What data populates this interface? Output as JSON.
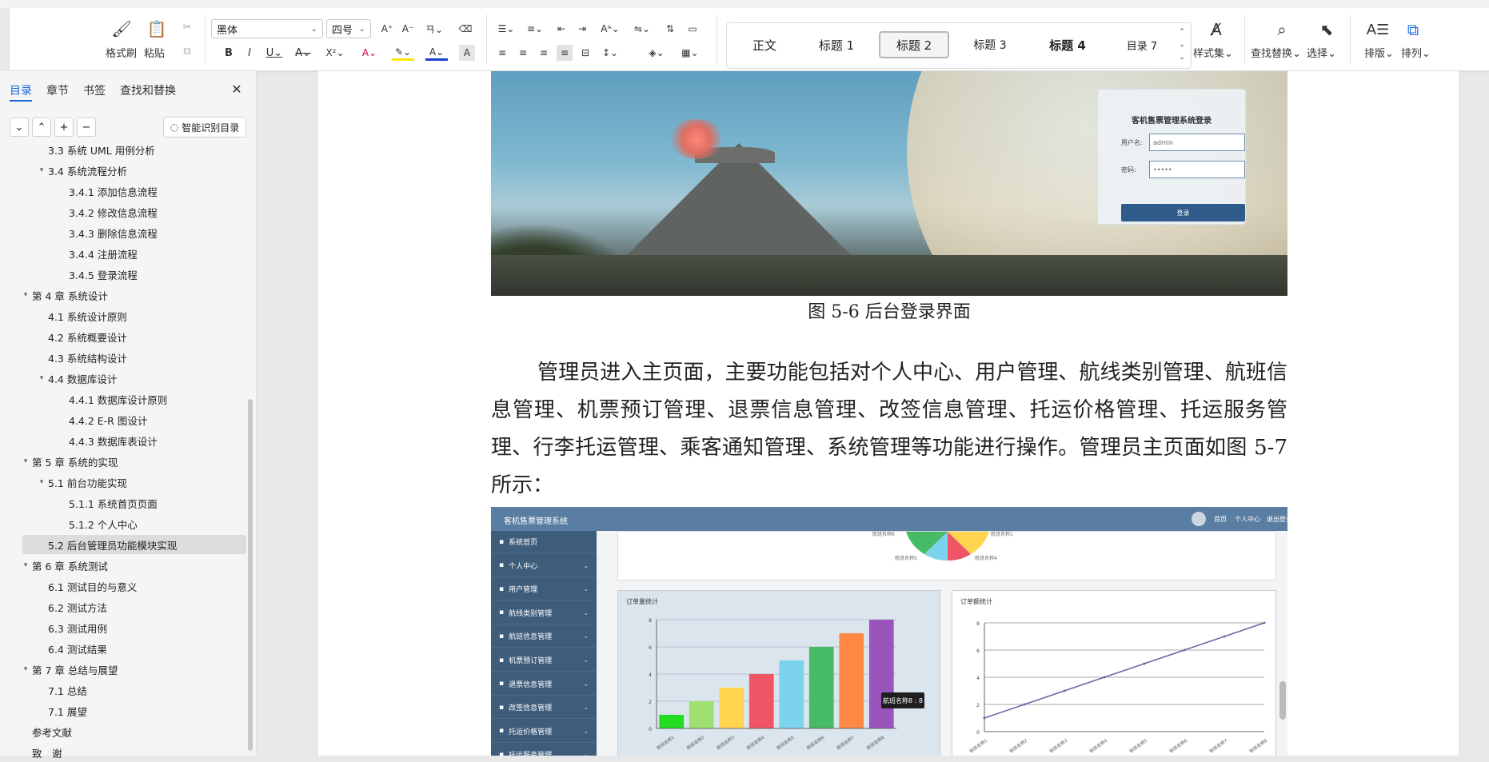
{
  "ribbon": {
    "clipboard": {
      "format_painter": "格式刷",
      "paste": "粘贴"
    },
    "font_name": "黑体",
    "font_size": "四号",
    "styles": [
      {
        "label": "正文"
      },
      {
        "label": "标题 1"
      },
      {
        "label": "标题 2",
        "selected": true
      },
      {
        "label": "标题 3"
      },
      {
        "label": "标题 4"
      },
      {
        "label": "目录 7"
      }
    ],
    "style_set": "样式集",
    "find_replace": "查找替换",
    "select": "选择",
    "layout": "排版",
    "arrange": "排列",
    "accent_color": "#1a66d9"
  },
  "nav": {
    "tabs": [
      "目录",
      "章节",
      "书签",
      "查找和替换"
    ],
    "smart_toc": "智能识别目录",
    "toc": [
      {
        "label": "3.3 系统 UML 用例分析",
        "level": 2,
        "expand": ""
      },
      {
        "label": "3.4 系统流程分析",
        "level": 2,
        "expand": "▾"
      },
      {
        "label": "3.4.1 添加信息流程",
        "level": 3,
        "expand": ""
      },
      {
        "label": "3.4.2 修改信息流程",
        "level": 3,
        "expand": ""
      },
      {
        "label": "3.4.3 删除信息流程",
        "level": 3,
        "expand": ""
      },
      {
        "label": "3.4.4 注册流程",
        "level": 3,
        "expand": ""
      },
      {
        "label": "3.4.5 登录流程",
        "level": 3,
        "expand": ""
      },
      {
        "label": "第 4 章 系统设计",
        "level": 1,
        "expand": "▾"
      },
      {
        "label": "4.1 系统设计原则",
        "level": 2,
        "expand": ""
      },
      {
        "label": "4.2 系统概要设计",
        "level": 2,
        "expand": ""
      },
      {
        "label": "4.3 系统结构设计",
        "level": 2,
        "expand": ""
      },
      {
        "label": "4.4 数据库设计",
        "level": 2,
        "expand": "▾"
      },
      {
        "label": "4.4.1 数据库设计原则",
        "level": 3,
        "expand": ""
      },
      {
        "label": "4.4.2 E-R 图设计",
        "level": 3,
        "expand": ""
      },
      {
        "label": "4.4.3 数据库表设计",
        "level": 3,
        "expand": ""
      },
      {
        "label": "第 5 章 系统的实现",
        "level": 1,
        "expand": "▾"
      },
      {
        "label": "5.1 前台功能实现",
        "level": 2,
        "expand": "▾"
      },
      {
        "label": "5.1.1 系统首页页面",
        "level": 3,
        "expand": ""
      },
      {
        "label": "5.1.2 个人中心",
        "level": 3,
        "expand": ""
      },
      {
        "label": "5.2 后台管理员功能模块实现",
        "level": 2,
        "expand": "",
        "selected": true
      },
      {
        "label": "第 6 章 系统测试",
        "level": 1,
        "expand": "▾"
      },
      {
        "label": "6.1 测试目的与意义",
        "level": 2,
        "expand": ""
      },
      {
        "label": "6.2 测试方法",
        "level": 2,
        "expand": ""
      },
      {
        "label": "6.3 测试用例",
        "level": 2,
        "expand": ""
      },
      {
        "label": "6.4 测试结果",
        "level": 2,
        "expand": ""
      },
      {
        "label": "第 7 章 总结与展望",
        "level": 1,
        "expand": "▾"
      },
      {
        "label": "7.1 总结",
        "level": 2,
        "expand": ""
      },
      {
        "label": "7.1 展望",
        "level": 2,
        "expand": ""
      },
      {
        "label": "参考文献",
        "level": 1,
        "expand": ""
      },
      {
        "label": "致　谢",
        "level": 1,
        "expand": ""
      }
    ]
  },
  "doc": {
    "login_screenshot": {
      "title": "客机售票管理系统登录",
      "username_label": "用户名:",
      "username_value": "admin",
      "password_label": "密码:",
      "password_value": "•••••",
      "login_button": "登录"
    },
    "caption": "图 5-6 后台登录界面",
    "paragraph": "管理员进入主页面，主要功能包括对个人中心、用户管理、航线类别管理、航班信息管理、机票预订管理、退票信息管理、改签信息管理、托运价格管理、托运服务管理、行李托运管理、乘客通知管理、系统管理等功能进行操作。管理员主页面如图 5-7 所示："
  },
  "admin_screenshot": {
    "app_title": "客机售票管理系统",
    "header_links": [
      "首页",
      "个人中心",
      "退出登录"
    ],
    "side_menu": [
      "系统首页",
      "个人中心",
      "用户管理",
      "航线类别管理",
      "航班信息管理",
      "机票预订管理",
      "退票信息管理",
      "改签信息管理",
      "托运价格管理",
      "托运服务管理"
    ],
    "pie_labels": [
      "航班名称6",
      "航班名称1",
      "航班名称5",
      "航班名称4"
    ],
    "bar_card_title": "订单量统计",
    "line_card_title": "订单额统计",
    "tooltip": "航班名称8 : 8"
  },
  "chart_data": [
    {
      "type": "bar",
      "title": "订单量统计",
      "categories": [
        "航班名称1",
        "航班名称2",
        "航班名称3",
        "航班名称4",
        "航班名称5",
        "航班名称6",
        "航班名称7",
        "航班名称8"
      ],
      "values": [
        1,
        2,
        3,
        4,
        5,
        6,
        7,
        8
      ],
      "colors": [
        "#22dd22",
        "#a0e070",
        "#ffd54f",
        "#ef5565",
        "#7cd3ee",
        "#45bb66",
        "#ff8844",
        "#9955bb"
      ],
      "ylim": [
        0,
        8
      ],
      "yticks": [
        0,
        2,
        4,
        6,
        8
      ]
    },
    {
      "type": "line",
      "title": "订单额统计",
      "categories": [
        "航班名称1",
        "航班名称2",
        "航班名称3",
        "航班名称4",
        "航班名称5",
        "航班名称6",
        "航班名称7",
        "航班名称8"
      ],
      "values": [
        1,
        2,
        3,
        4,
        5,
        6,
        7,
        8
      ],
      "ylim": [
        0,
        8
      ],
      "yticks": [
        0,
        2,
        4,
        6,
        8
      ],
      "color": "#6666aa"
    }
  ]
}
